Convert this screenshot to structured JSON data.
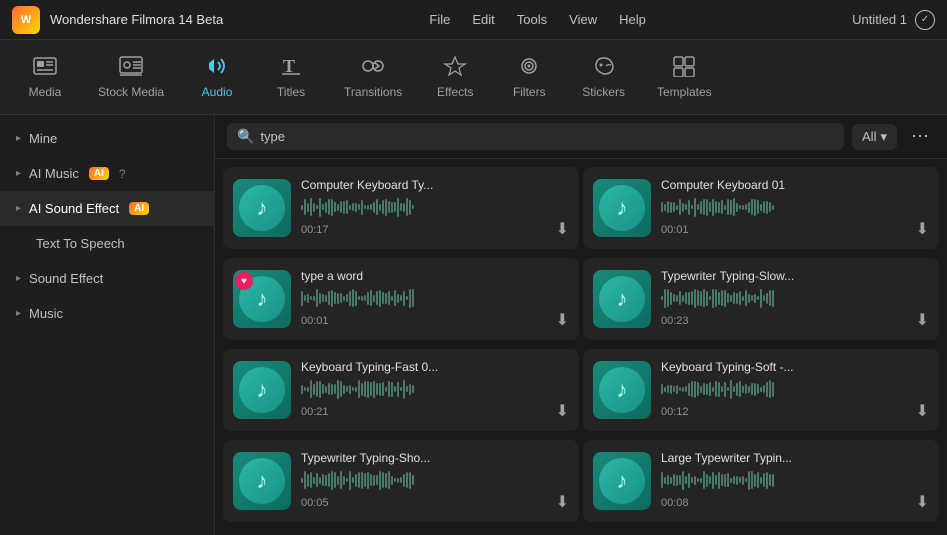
{
  "titleBar": {
    "appName": "Wondershare Filmora 14 Beta",
    "menus": [
      "File",
      "Edit",
      "Tools",
      "View",
      "Help"
    ],
    "projectName": "Untitled 1"
  },
  "topNav": {
    "items": [
      {
        "id": "media",
        "label": "Media",
        "icon": "🖼"
      },
      {
        "id": "stock-media",
        "label": "Stock Media",
        "icon": "🎞"
      },
      {
        "id": "audio",
        "label": "Audio",
        "icon": "♪",
        "active": true
      },
      {
        "id": "titles",
        "label": "Titles",
        "icon": "T"
      },
      {
        "id": "transitions",
        "label": "Transitions",
        "icon": "⇄"
      },
      {
        "id": "effects",
        "label": "Effects",
        "icon": "✦"
      },
      {
        "id": "filters",
        "label": "Filters",
        "icon": "◉"
      },
      {
        "id": "stickers",
        "label": "Stickers",
        "icon": "✂"
      },
      {
        "id": "templates",
        "label": "Templates",
        "icon": "⊞"
      }
    ]
  },
  "sidebar": {
    "items": [
      {
        "id": "mine",
        "label": "Mine",
        "hasArrow": true,
        "expanded": false
      },
      {
        "id": "ai-music",
        "label": "AI Music",
        "hasArrow": true,
        "hasBadge": true,
        "badgeText": "AI",
        "hasHelp": true
      },
      {
        "id": "ai-sound-effect",
        "label": "AI Sound Effect",
        "hasArrow": true,
        "hasBadge": true,
        "badgeText": "AI"
      },
      {
        "id": "text-to-speech",
        "label": "Text To Speech",
        "isSubItem": true
      },
      {
        "id": "sound-effect",
        "label": "Sound Effect",
        "hasArrow": true
      },
      {
        "id": "music",
        "label": "Music",
        "hasArrow": true
      }
    ]
  },
  "search": {
    "placeholder": "type",
    "filterLabel": "All",
    "currentValue": "type"
  },
  "audioCards": [
    {
      "id": "card1",
      "title": "Computer Keyboard Ty...",
      "duration": "00:17",
      "hasBadge": false
    },
    {
      "id": "card2",
      "title": "Computer Keyboard 01",
      "duration": "00:01",
      "hasBadge": false
    },
    {
      "id": "card3",
      "title": "type a word",
      "duration": "00:01",
      "hasBadge": true
    },
    {
      "id": "card4",
      "title": "Typewriter Typing-Slow...",
      "duration": "00:23",
      "hasBadge": false
    },
    {
      "id": "card5",
      "title": "Keyboard Typing-Fast 0...",
      "duration": "00:21",
      "hasBadge": false
    },
    {
      "id": "card6",
      "title": "Keyboard Typing-Soft -...",
      "duration": "00:12",
      "hasBadge": false
    },
    {
      "id": "card7",
      "title": "Typewriter Typing-Sho...",
      "duration": "00:05",
      "hasBadge": false
    },
    {
      "id": "card8",
      "title": "Large Typewriter Typin...",
      "duration": "00:08",
      "hasBadge": false
    }
  ],
  "icons": {
    "search": "🔍",
    "download": "⬇",
    "chevronDown": "▾",
    "chevronRight": "▸",
    "musicNote": "♪",
    "heart": "♥"
  }
}
